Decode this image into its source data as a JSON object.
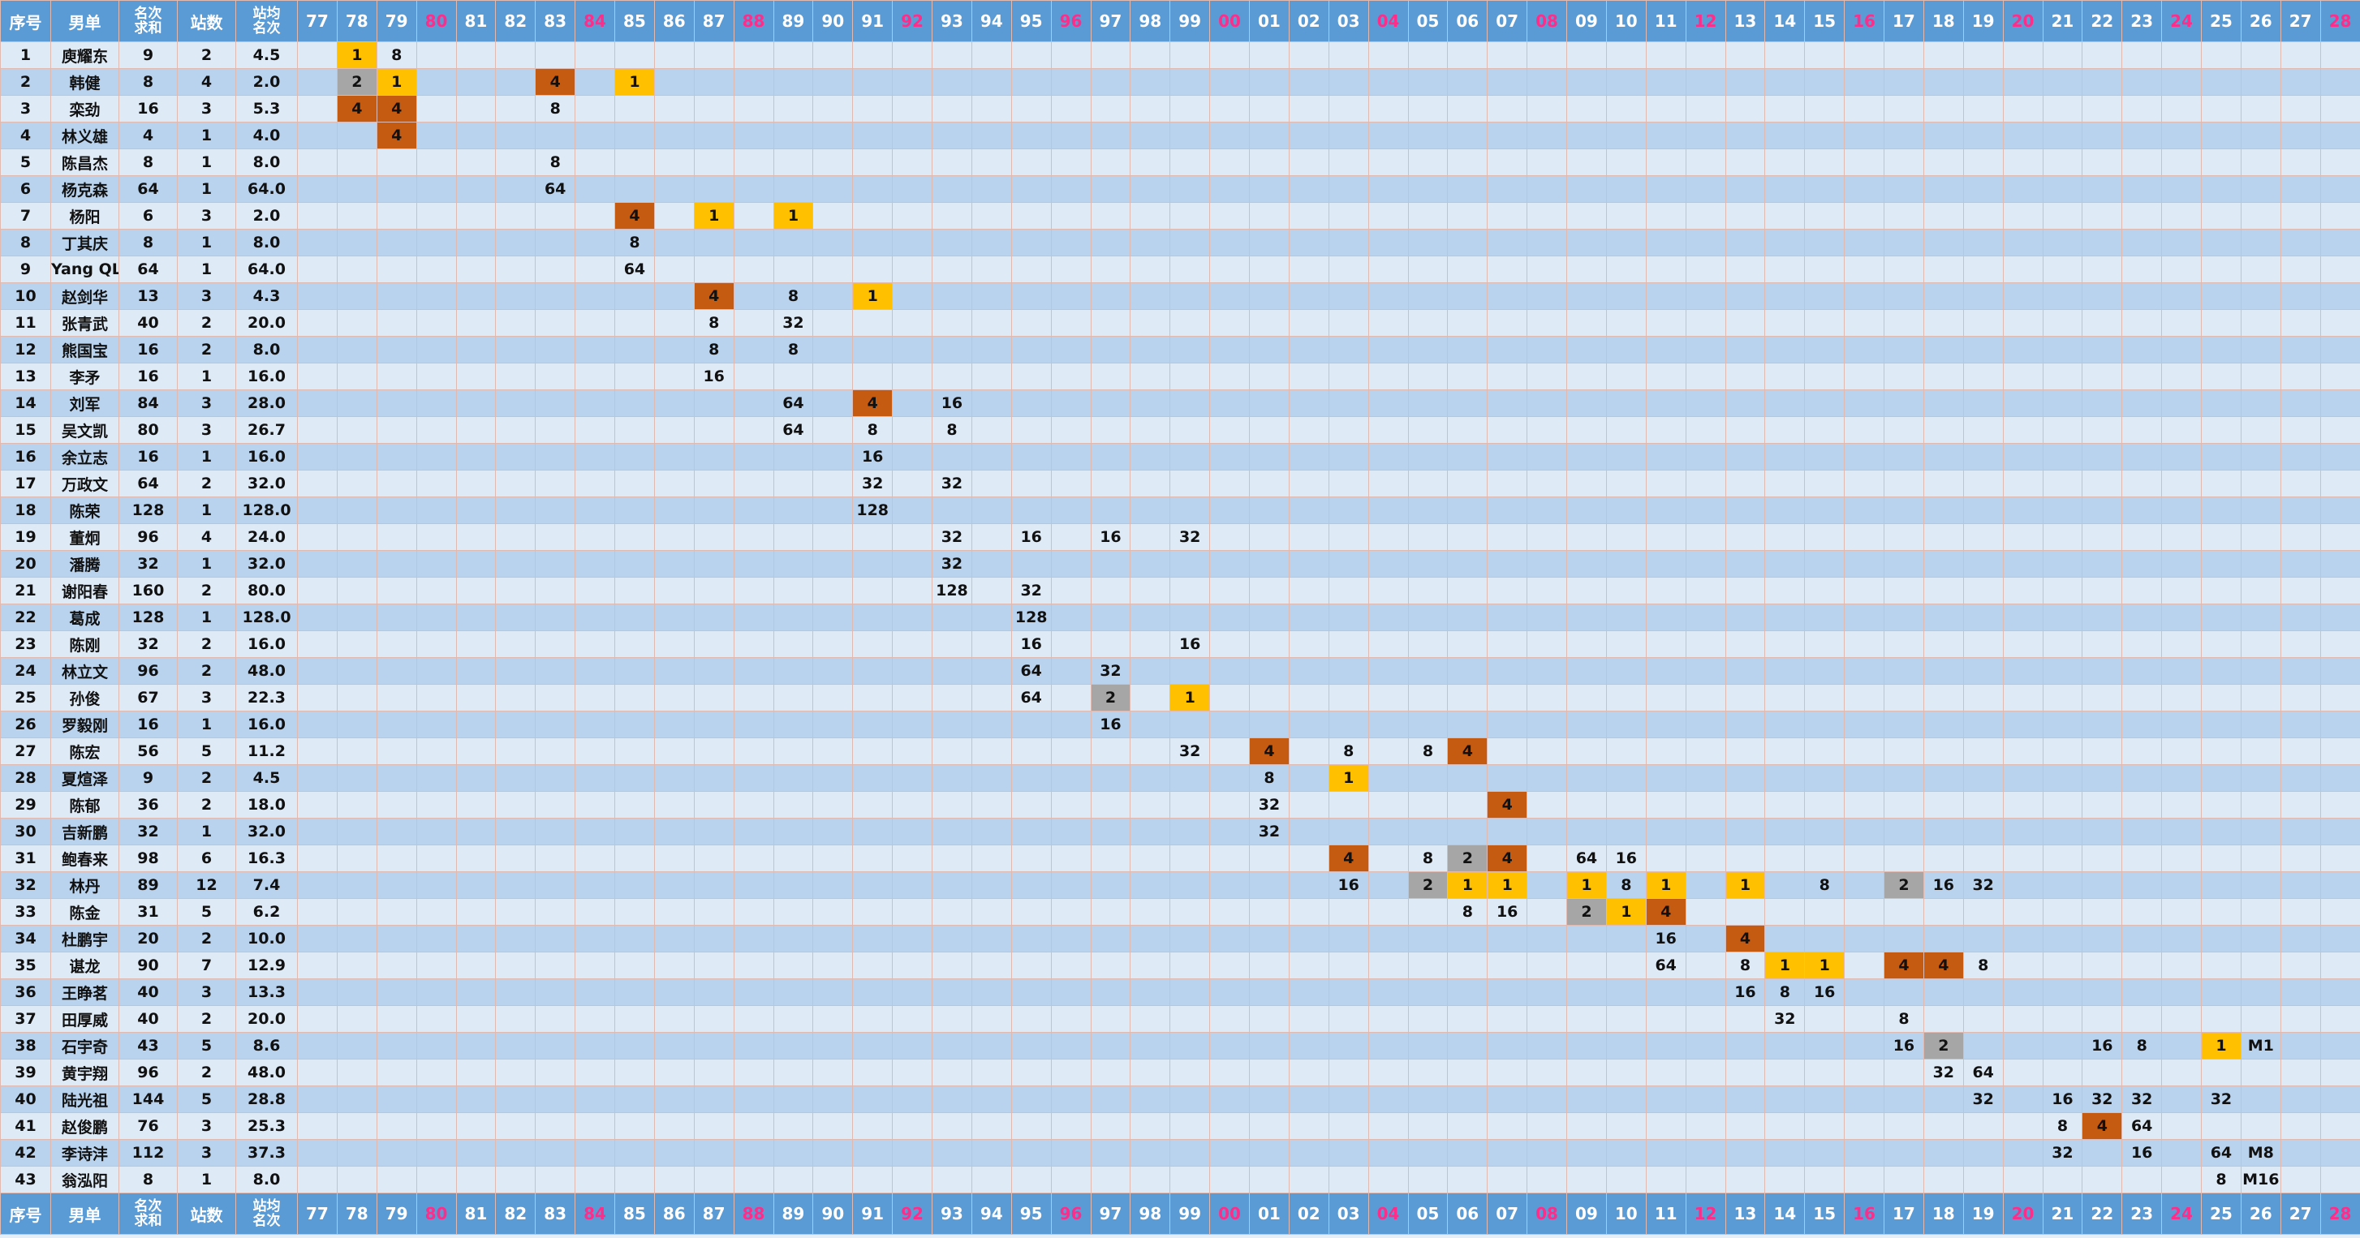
{
  "header": {
    "seq": "序号",
    "player": "男单",
    "sum": [
      "名次",
      "求和"
    ],
    "count": "站数",
    "avg": [
      "站均",
      "名次"
    ]
  },
  "years": [
    "77",
    "78",
    "79",
    "80",
    "81",
    "82",
    "83",
    "84",
    "85",
    "86",
    "87",
    "88",
    "89",
    "90",
    "91",
    "92",
    "93",
    "94",
    "95",
    "96",
    "97",
    "98",
    "99",
    "00",
    "01",
    "02",
    "03",
    "04",
    "05",
    "06",
    "07",
    "08",
    "09",
    "10",
    "11",
    "12",
    "13",
    "14",
    "15",
    "16",
    "17",
    "18",
    "19",
    "20",
    "21",
    "22",
    "23",
    "24",
    "25",
    "26",
    "27",
    "28"
  ],
  "olympic_years": [
    "80",
    "84",
    "88",
    "92",
    "96",
    "00",
    "04",
    "08",
    "12",
    "16",
    "20",
    "24",
    "28"
  ],
  "colors": {
    "header_bg": "#5b9bd5",
    "olympic_year_text": "#ff2d8a",
    "rank_1": "#ffc000",
    "rank_2": "#a6a6a6",
    "rank_4": "#c55a11",
    "row_light": "#dfeaf7",
    "row_dark": "#b9d3ee"
  },
  "rows": [
    {
      "seq": "1",
      "name": "庾耀东",
      "sum": "9",
      "count": "2",
      "avg": "4.5",
      "results": {
        "78": "1",
        "79": "8"
      }
    },
    {
      "seq": "2",
      "name": "韩健",
      "sum": "8",
      "count": "4",
      "avg": "2.0",
      "results": {
        "78": "2",
        "79": "1",
        "83": "4",
        "85": "1"
      }
    },
    {
      "seq": "3",
      "name": "栾劲",
      "sum": "16",
      "count": "3",
      "avg": "5.3",
      "results": {
        "78": "4",
        "79": "4",
        "83": "8"
      }
    },
    {
      "seq": "4",
      "name": "林义雄",
      "sum": "4",
      "count": "1",
      "avg": "4.0",
      "results": {
        "79": "4"
      }
    },
    {
      "seq": "5",
      "name": "陈昌杰",
      "sum": "8",
      "count": "1",
      "avg": "8.0",
      "results": {
        "83": "8"
      }
    },
    {
      "seq": "6",
      "name": "杨克森",
      "sum": "64",
      "count": "1",
      "avg": "64.0",
      "results": {
        "83": "64"
      }
    },
    {
      "seq": "7",
      "name": "杨阳",
      "sum": "6",
      "count": "3",
      "avg": "2.0",
      "results": {
        "85": "4",
        "87": "1",
        "89": "1"
      }
    },
    {
      "seq": "8",
      "name": "丁其庆",
      "sum": "8",
      "count": "1",
      "avg": "8.0",
      "results": {
        "85": "8"
      }
    },
    {
      "seq": "9",
      "name": "Yang QL",
      "sum": "64",
      "count": "1",
      "avg": "64.0",
      "results": {
        "85": "64"
      }
    },
    {
      "seq": "10",
      "name": "赵剑华",
      "sum": "13",
      "count": "3",
      "avg": "4.3",
      "results": {
        "87": "4",
        "89": "8",
        "91": "1"
      }
    },
    {
      "seq": "11",
      "name": "张青武",
      "sum": "40",
      "count": "2",
      "avg": "20.0",
      "results": {
        "87": "8",
        "89": "32"
      }
    },
    {
      "seq": "12",
      "name": "熊国宝",
      "sum": "16",
      "count": "2",
      "avg": "8.0",
      "results": {
        "87": "8",
        "89": "8"
      }
    },
    {
      "seq": "13",
      "name": "李矛",
      "sum": "16",
      "count": "1",
      "avg": "16.0",
      "results": {
        "87": "16"
      }
    },
    {
      "seq": "14",
      "name": "刘军",
      "sum": "84",
      "count": "3",
      "avg": "28.0",
      "results": {
        "89": "64",
        "91": "4",
        "93": "16"
      }
    },
    {
      "seq": "15",
      "name": "吴文凯",
      "sum": "80",
      "count": "3",
      "avg": "26.7",
      "results": {
        "89": "64",
        "91": "8",
        "93": "8"
      }
    },
    {
      "seq": "16",
      "name": "余立志",
      "sum": "16",
      "count": "1",
      "avg": "16.0",
      "results": {
        "91": "16"
      }
    },
    {
      "seq": "17",
      "name": "万政文",
      "sum": "64",
      "count": "2",
      "avg": "32.0",
      "results": {
        "91": "32",
        "93": "32"
      }
    },
    {
      "seq": "18",
      "name": "陈荣",
      "sum": "128",
      "count": "1",
      "avg": "128.0",
      "results": {
        "91": "128"
      }
    },
    {
      "seq": "19",
      "name": "董炯",
      "sum": "96",
      "count": "4",
      "avg": "24.0",
      "results": {
        "93": "32",
        "95": "16",
        "97": "16",
        "99": "32"
      }
    },
    {
      "seq": "20",
      "name": "潘腾",
      "sum": "32",
      "count": "1",
      "avg": "32.0",
      "results": {
        "93": "32"
      }
    },
    {
      "seq": "21",
      "name": "谢阳春",
      "sum": "160",
      "count": "2",
      "avg": "80.0",
      "results": {
        "93": "128",
        "95": "32"
      }
    },
    {
      "seq": "22",
      "name": "葛成",
      "sum": "128",
      "count": "1",
      "avg": "128.0",
      "results": {
        "95": "128"
      }
    },
    {
      "seq": "23",
      "name": "陈刚",
      "sum": "32",
      "count": "2",
      "avg": "16.0",
      "results": {
        "95": "16",
        "99": "16"
      }
    },
    {
      "seq": "24",
      "name": "林立文",
      "sum": "96",
      "count": "2",
      "avg": "48.0",
      "results": {
        "95": "64",
        "97": "32"
      }
    },
    {
      "seq": "25",
      "name": "孙俊",
      "sum": "67",
      "count": "3",
      "avg": "22.3",
      "results": {
        "95": "64",
        "97": "2",
        "99": "1"
      }
    },
    {
      "seq": "26",
      "name": "罗毅刚",
      "sum": "16",
      "count": "1",
      "avg": "16.0",
      "results": {
        "97": "16"
      }
    },
    {
      "seq": "27",
      "name": "陈宏",
      "sum": "56",
      "count": "5",
      "avg": "11.2",
      "results": {
        "99": "32",
        "01": "4",
        "03": "8",
        "05": "8",
        "06": "4"
      }
    },
    {
      "seq": "28",
      "name": "夏煊泽",
      "sum": "9",
      "count": "2",
      "avg": "4.5",
      "results": {
        "01": "8",
        "03": "1"
      }
    },
    {
      "seq": "29",
      "name": "陈郁",
      "sum": "36",
      "count": "2",
      "avg": "18.0",
      "results": {
        "01": "32",
        "07": "4"
      }
    },
    {
      "seq": "30",
      "name": "吉新鹏",
      "sum": "32",
      "count": "1",
      "avg": "32.0",
      "results": {
        "01": "32"
      }
    },
    {
      "seq": "31",
      "name": "鲍春来",
      "sum": "98",
      "count": "6",
      "avg": "16.3",
      "results": {
        "03": "4",
        "05": "8",
        "06": "2",
        "07": "4",
        "09": "64",
        "10": "16"
      }
    },
    {
      "seq": "32",
      "name": "林丹",
      "sum": "89",
      "count": "12",
      "avg": "7.4",
      "results": {
        "03": "16",
        "05": "2",
        "06": "1",
        "07": "1",
        "09": "1",
        "10": "8",
        "11": "1",
        "13": "1",
        "15": "8",
        "17": "2",
        "18": "16",
        "19": "32"
      }
    },
    {
      "seq": "33",
      "name": "陈金",
      "sum": "31",
      "count": "5",
      "avg": "6.2",
      "results": {
        "06": "8",
        "07": "16",
        "09": "2",
        "10": "1",
        "11": "4"
      }
    },
    {
      "seq": "34",
      "name": "杜鹏宇",
      "sum": "20",
      "count": "2",
      "avg": "10.0",
      "results": {
        "11": "16",
        "13": "4"
      }
    },
    {
      "seq": "35",
      "name": "谌龙",
      "sum": "90",
      "count": "7",
      "avg": "12.9",
      "results": {
        "11": "64",
        "13": "8",
        "14": "1",
        "15": "1",
        "17": "4",
        "18": "4",
        "19": "8"
      }
    },
    {
      "seq": "36",
      "name": "王睁茗",
      "sum": "40",
      "count": "3",
      "avg": "13.3",
      "results": {
        "13": "16",
        "14": "8",
        "15": "16"
      }
    },
    {
      "seq": "37",
      "name": "田厚威",
      "sum": "40",
      "count": "2",
      "avg": "20.0",
      "results": {
        "14": "32",
        "17": "8"
      }
    },
    {
      "seq": "38",
      "name": "石宇奇",
      "sum": "43",
      "count": "5",
      "avg": "8.6",
      "results": {
        "17": "16",
        "18": "2",
        "22": "16",
        "23": "8",
        "25": "1",
        "26": "M1"
      }
    },
    {
      "seq": "39",
      "name": "黄宇翔",
      "sum": "96",
      "count": "2",
      "avg": "48.0",
      "results": {
        "18": "32",
        "19": "64"
      }
    },
    {
      "seq": "40",
      "name": "陆光祖",
      "sum": "144",
      "count": "5",
      "avg": "28.8",
      "results": {
        "19": "32",
        "21": "16",
        "22": "32",
        "23": "32",
        "25": "32"
      }
    },
    {
      "seq": "41",
      "name": "赵俊鹏",
      "sum": "76",
      "count": "3",
      "avg": "25.3",
      "results": {
        "21": "8",
        "22": "4",
        "23": "64"
      }
    },
    {
      "seq": "42",
      "name": "李诗沣",
      "sum": "112",
      "count": "3",
      "avg": "37.3",
      "results": {
        "21": "32",
        "23": "16",
        "25": "64",
        "26": "M8"
      }
    },
    {
      "seq": "43",
      "name": "翁泓阳",
      "sum": "8",
      "count": "1",
      "avg": "8.0",
      "results": {
        "25": "8",
        "26": "M16"
      }
    }
  ]
}
